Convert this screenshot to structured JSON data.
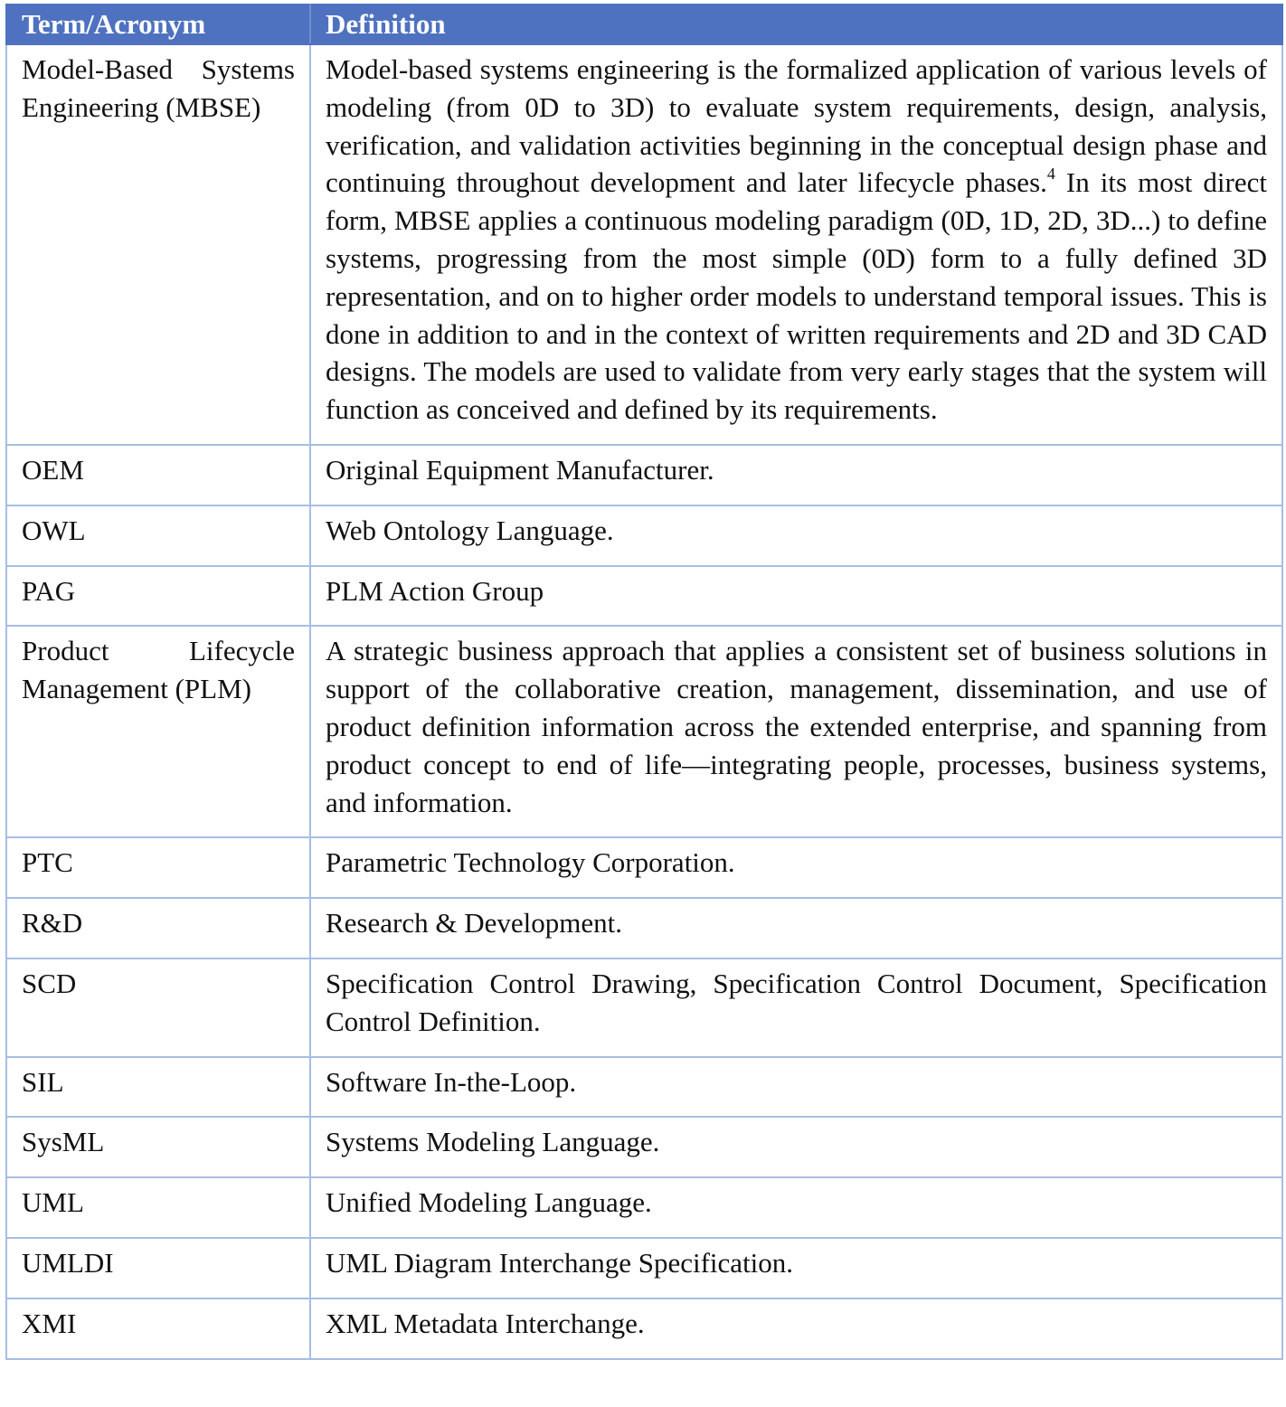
{
  "table": {
    "header": {
      "term": "Term/Acronym",
      "definition": "Definition"
    },
    "colors": {
      "header_background": "#4f72c0",
      "header_text": "#ffffff",
      "grid_line": "#a8bde3"
    },
    "rows": [
      {
        "term": "Model-Based Systems Engineering (MBSE)",
        "definition_part1": "Model-based systems engineering is the formalized application of various levels of modeling (from 0D to 3D) to evaluate system requirements, design, analysis, verification, and validation activities beginning in the conceptual design phase and continuing throughout development and later lifecycle phases.",
        "footnote": "4",
        "definition_part2": " In its most direct form, MBSE applies a continuous modeling paradigm (0D, 1D, 2D, 3D...) to define systems, progressing from the most simple (0D) form to a fully defined 3D representation, and on to higher order models to understand temporal issues. This is done in addition to and in the context of written requirements and 2D and 3D CAD designs. The models are used to validate from very early stages that the system will function as conceived and defined by its requirements."
      },
      {
        "term": "OEM",
        "definition": "Original Equipment Manufacturer."
      },
      {
        "term": "OWL",
        "definition": "Web Ontology Language."
      },
      {
        "term": "PAG",
        "definition": "PLM Action Group"
      },
      {
        "term": "Product Lifecycle Management (PLM)",
        "definition": "A strategic business approach that applies a consistent set of business solutions in support of the collaborative creation, management, dissemination, and use of product definition information across the extended enterprise, and spanning from product concept to end of life—integrating people, processes, business systems, and information."
      },
      {
        "term": "PTC",
        "definition": "Parametric Technology Corporation."
      },
      {
        "term": "R&D",
        "definition": "Research & Development."
      },
      {
        "term": "SCD",
        "definition": "Specification Control Drawing, Specification Control Document, Specification Control Definition."
      },
      {
        "term": "SIL",
        "definition": "Software In-the-Loop."
      },
      {
        "term": "SysML",
        "definition": "Systems Modeling Language."
      },
      {
        "term": "UML",
        "definition": "Unified Modeling Language."
      },
      {
        "term": "UMLDI",
        "definition": "UML Diagram Interchange Specification."
      },
      {
        "term": "XMI",
        "definition": "XML Metadata Interchange."
      }
    ]
  }
}
